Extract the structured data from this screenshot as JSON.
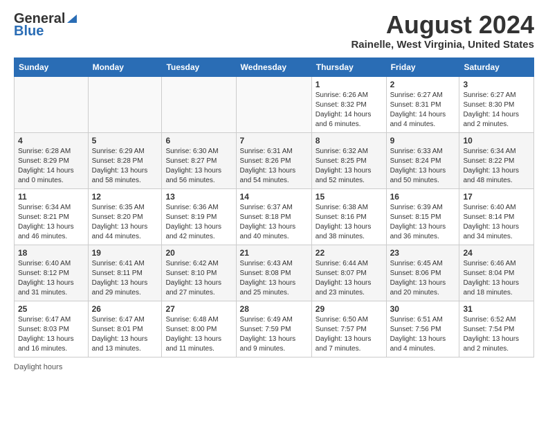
{
  "header": {
    "logo_line1": "General",
    "logo_line2": "Blue",
    "month_year": "August 2024",
    "location": "Rainelle, West Virginia, United States"
  },
  "days_of_week": [
    "Sunday",
    "Monday",
    "Tuesday",
    "Wednesday",
    "Thursday",
    "Friday",
    "Saturday"
  ],
  "weeks": [
    [
      {
        "day": "",
        "info": ""
      },
      {
        "day": "",
        "info": ""
      },
      {
        "day": "",
        "info": ""
      },
      {
        "day": "",
        "info": ""
      },
      {
        "day": "1",
        "info": "Sunrise: 6:26 AM\nSunset: 8:32 PM\nDaylight: 14 hours and 6 minutes."
      },
      {
        "day": "2",
        "info": "Sunrise: 6:27 AM\nSunset: 8:31 PM\nDaylight: 14 hours and 4 minutes."
      },
      {
        "day": "3",
        "info": "Sunrise: 6:27 AM\nSunset: 8:30 PM\nDaylight: 14 hours and 2 minutes."
      }
    ],
    [
      {
        "day": "4",
        "info": "Sunrise: 6:28 AM\nSunset: 8:29 PM\nDaylight: 14 hours and 0 minutes."
      },
      {
        "day": "5",
        "info": "Sunrise: 6:29 AM\nSunset: 8:28 PM\nDaylight: 13 hours and 58 minutes."
      },
      {
        "day": "6",
        "info": "Sunrise: 6:30 AM\nSunset: 8:27 PM\nDaylight: 13 hours and 56 minutes."
      },
      {
        "day": "7",
        "info": "Sunrise: 6:31 AM\nSunset: 8:26 PM\nDaylight: 13 hours and 54 minutes."
      },
      {
        "day": "8",
        "info": "Sunrise: 6:32 AM\nSunset: 8:25 PM\nDaylight: 13 hours and 52 minutes."
      },
      {
        "day": "9",
        "info": "Sunrise: 6:33 AM\nSunset: 8:24 PM\nDaylight: 13 hours and 50 minutes."
      },
      {
        "day": "10",
        "info": "Sunrise: 6:34 AM\nSunset: 8:22 PM\nDaylight: 13 hours and 48 minutes."
      }
    ],
    [
      {
        "day": "11",
        "info": "Sunrise: 6:34 AM\nSunset: 8:21 PM\nDaylight: 13 hours and 46 minutes."
      },
      {
        "day": "12",
        "info": "Sunrise: 6:35 AM\nSunset: 8:20 PM\nDaylight: 13 hours and 44 minutes."
      },
      {
        "day": "13",
        "info": "Sunrise: 6:36 AM\nSunset: 8:19 PM\nDaylight: 13 hours and 42 minutes."
      },
      {
        "day": "14",
        "info": "Sunrise: 6:37 AM\nSunset: 8:18 PM\nDaylight: 13 hours and 40 minutes."
      },
      {
        "day": "15",
        "info": "Sunrise: 6:38 AM\nSunset: 8:16 PM\nDaylight: 13 hours and 38 minutes."
      },
      {
        "day": "16",
        "info": "Sunrise: 6:39 AM\nSunset: 8:15 PM\nDaylight: 13 hours and 36 minutes."
      },
      {
        "day": "17",
        "info": "Sunrise: 6:40 AM\nSunset: 8:14 PM\nDaylight: 13 hours and 34 minutes."
      }
    ],
    [
      {
        "day": "18",
        "info": "Sunrise: 6:40 AM\nSunset: 8:12 PM\nDaylight: 13 hours and 31 minutes."
      },
      {
        "day": "19",
        "info": "Sunrise: 6:41 AM\nSunset: 8:11 PM\nDaylight: 13 hours and 29 minutes."
      },
      {
        "day": "20",
        "info": "Sunrise: 6:42 AM\nSunset: 8:10 PM\nDaylight: 13 hours and 27 minutes."
      },
      {
        "day": "21",
        "info": "Sunrise: 6:43 AM\nSunset: 8:08 PM\nDaylight: 13 hours and 25 minutes."
      },
      {
        "day": "22",
        "info": "Sunrise: 6:44 AM\nSunset: 8:07 PM\nDaylight: 13 hours and 23 minutes."
      },
      {
        "day": "23",
        "info": "Sunrise: 6:45 AM\nSunset: 8:06 PM\nDaylight: 13 hours and 20 minutes."
      },
      {
        "day": "24",
        "info": "Sunrise: 6:46 AM\nSunset: 8:04 PM\nDaylight: 13 hours and 18 minutes."
      }
    ],
    [
      {
        "day": "25",
        "info": "Sunrise: 6:47 AM\nSunset: 8:03 PM\nDaylight: 13 hours and 16 minutes."
      },
      {
        "day": "26",
        "info": "Sunrise: 6:47 AM\nSunset: 8:01 PM\nDaylight: 13 hours and 13 minutes."
      },
      {
        "day": "27",
        "info": "Sunrise: 6:48 AM\nSunset: 8:00 PM\nDaylight: 13 hours and 11 minutes."
      },
      {
        "day": "28",
        "info": "Sunrise: 6:49 AM\nSunset: 7:59 PM\nDaylight: 13 hours and 9 minutes."
      },
      {
        "day": "29",
        "info": "Sunrise: 6:50 AM\nSunset: 7:57 PM\nDaylight: 13 hours and 7 minutes."
      },
      {
        "day": "30",
        "info": "Sunrise: 6:51 AM\nSunset: 7:56 PM\nDaylight: 13 hours and 4 minutes."
      },
      {
        "day": "31",
        "info": "Sunrise: 6:52 AM\nSunset: 7:54 PM\nDaylight: 13 hours and 2 minutes."
      }
    ]
  ],
  "footer": {
    "text": "Daylight hours"
  }
}
